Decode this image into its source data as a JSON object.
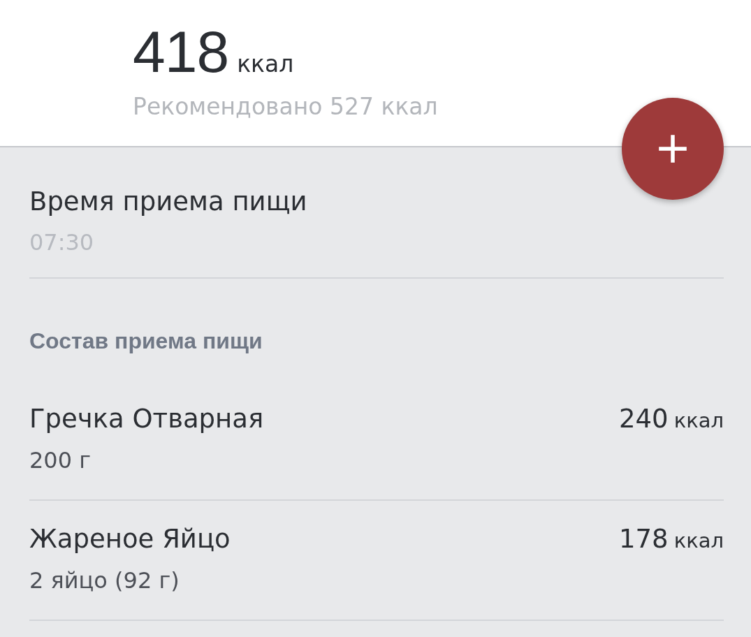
{
  "summary": {
    "calories": "418",
    "unit": "ккал",
    "recommended": "Рекомендовано 527 ккал"
  },
  "meal_time": {
    "label": "Время приема пищи",
    "value": "07:30"
  },
  "composition": {
    "title": "Состав приема пищи",
    "items": [
      {
        "name": "Гречка Отварная",
        "portion": "200 г",
        "calories": "240",
        "unit": "ккал"
      },
      {
        "name": "Жареное Яйцо",
        "portion": "2 яйцо (92 г)",
        "calories": "178",
        "unit": "ккал"
      }
    ]
  }
}
